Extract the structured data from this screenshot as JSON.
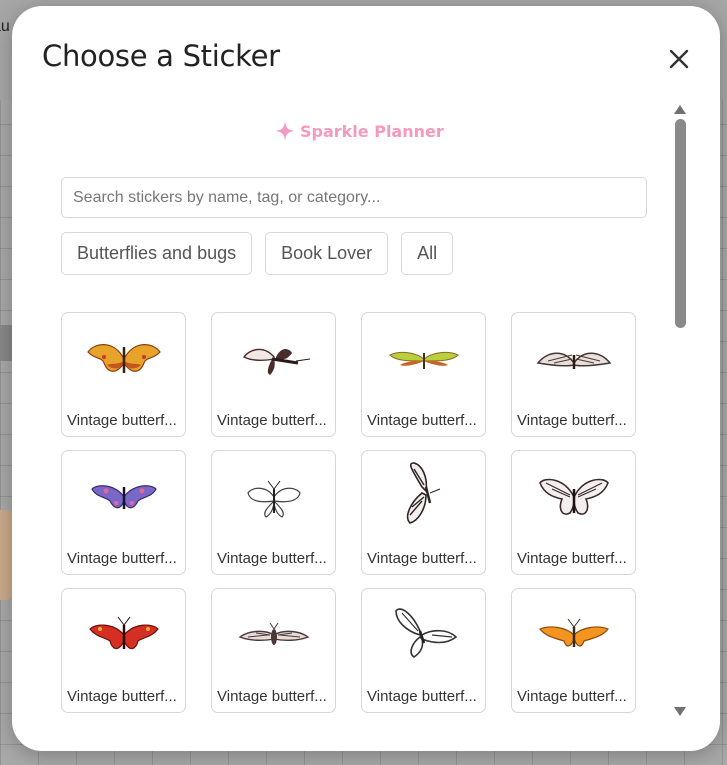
{
  "modal": {
    "title": "Choose a Sticker",
    "brand": "Sparkle Planner",
    "search_placeholder": "Search stickers by name, tag, or category...",
    "search_value": ""
  },
  "background": {
    "cut_text": "au"
  },
  "filters": [
    "Butterflies and bugs",
    "Book Lover",
    "All"
  ],
  "stickers": [
    {
      "label": "Vintage butterf...",
      "colors": [
        "#e8a32b",
        "#c2561c"
      ]
    },
    {
      "label": "Vintage butterf...",
      "colors": [
        "#4a2e2a",
        "#f2e9e4"
      ]
    },
    {
      "label": "Vintage butterf...",
      "colors": [
        "#b9cf3c",
        "#c8642a"
      ]
    },
    {
      "label": "Vintage butterf...",
      "colors": [
        "#4a3535",
        "#e8e0dc"
      ]
    },
    {
      "label": "Vintage butterf...",
      "colors": [
        "#7a68c8",
        "#e7669e"
      ]
    },
    {
      "label": "Vintage butterf...",
      "colors": [
        "#ffffff",
        "#444444"
      ]
    },
    {
      "label": "Vintage butterf...",
      "colors": [
        "#2f2424",
        "#f4efec"
      ]
    },
    {
      "label": "Vintage butterf...",
      "colors": [
        "#3a2b2b",
        "#f4eeee"
      ]
    },
    {
      "label": "Vintage butterf...",
      "colors": [
        "#d52f22",
        "#f3b236"
      ]
    },
    {
      "label": "Vintage butterf...",
      "colors": [
        "#4b3838",
        "#e6ddd8"
      ]
    },
    {
      "label": "Vintage butterf...",
      "colors": [
        "#ffffff",
        "#333333"
      ]
    },
    {
      "label": "Vintage butterf...",
      "colors": [
        "#f3951f",
        "#3a2a1c"
      ]
    }
  ],
  "icons": {
    "close": "close-icon",
    "brand": "sparkle-icon",
    "scroll_up": "triangle-up-icon",
    "scroll_down": "triangle-down-icon"
  },
  "colors": {
    "brand_pink": "#f49ac1",
    "scrollbar": "#8a8a8a"
  }
}
